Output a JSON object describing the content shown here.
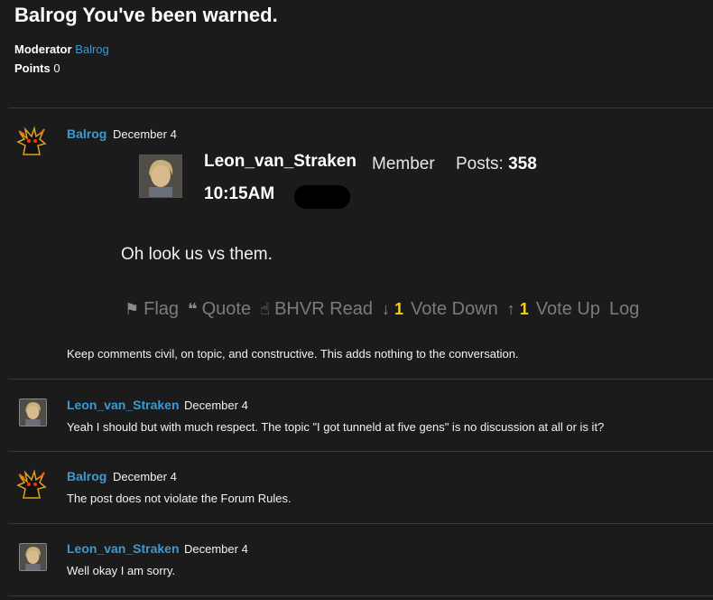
{
  "discussion": {
    "title": "Balrog You've been warned.",
    "moderator_label": "Moderator",
    "moderator_name": "Balrog",
    "points_label": "Points",
    "points_value": "0"
  },
  "comments": [
    {
      "author": "Balrog",
      "date": "December 4",
      "avatar_icon": "balrog-avatar",
      "quote": {
        "name": "Leon_van_Straken",
        "role": "Member",
        "posts_label": "Posts:",
        "posts_value": "358",
        "time": "10:15AM",
        "text": "Oh look us vs them.",
        "actions": {
          "flag": "Flag",
          "quote": "Quote",
          "bhvr_read": "BHVR Read",
          "vote_down_count": "1",
          "vote_down": "Vote Down",
          "vote_up_count": "1",
          "vote_up": "Vote Up",
          "log": "Log"
        }
      },
      "body": "Keep comments civil, on topic, and constructive. This adds nothing to the conversation."
    },
    {
      "author": "Leon_van_Straken",
      "date": "December 4",
      "avatar_icon": "leon-avatar",
      "body": "Yeah I should but with much respect. The topic \"I got tunneld at five gens\" is no discussion at all or is it?"
    },
    {
      "author": "Balrog",
      "date": "December 4",
      "avatar_icon": "balrog-avatar",
      "body": "The post does not violate the Forum Rules."
    },
    {
      "author": "Leon_van_Straken",
      "date": "December 4",
      "avatar_icon": "leon-avatar",
      "body": "Well okay I am sorry."
    }
  ],
  "colors": {
    "background": "#1b1b1b",
    "link": "#3d9ad1",
    "vote_count": "#f5d300"
  }
}
